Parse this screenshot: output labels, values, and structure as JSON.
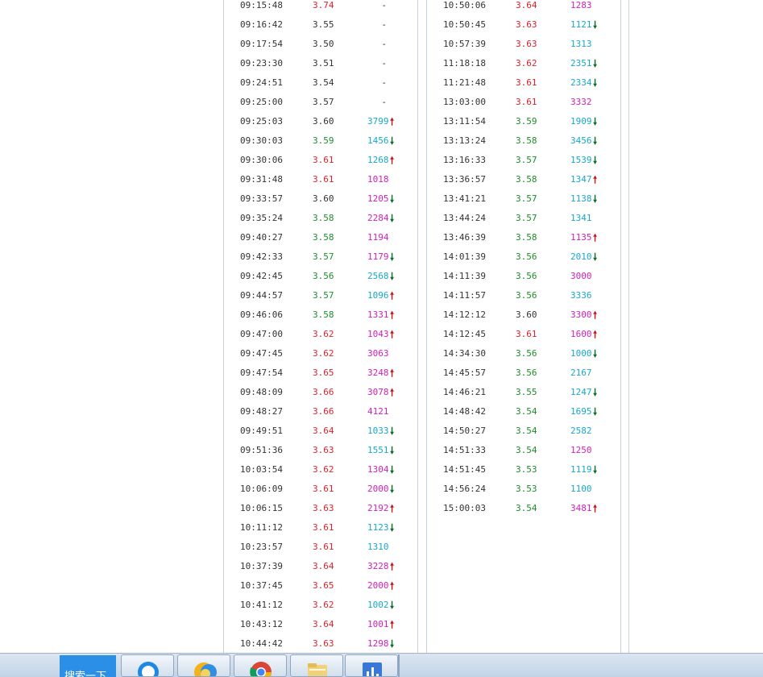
{
  "left_trades": [
    {
      "time": "09:15:48",
      "price": "3.74",
      "price_color": "red",
      "volume": "-",
      "volume_color": "dark",
      "arrow": ""
    },
    {
      "time": "09:16:42",
      "price": "3.55",
      "price_color": "dark",
      "volume": "-",
      "volume_color": "dark",
      "arrow": ""
    },
    {
      "time": "09:17:54",
      "price": "3.50",
      "price_color": "dark",
      "volume": "-",
      "volume_color": "dark",
      "arrow": ""
    },
    {
      "time": "09:23:30",
      "price": "3.51",
      "price_color": "dark",
      "volume": "-",
      "volume_color": "dark",
      "arrow": ""
    },
    {
      "time": "09:24:51",
      "price": "3.54",
      "price_color": "dark",
      "volume": "-",
      "volume_color": "dark",
      "arrow": ""
    },
    {
      "time": "09:25:00",
      "price": "3.57",
      "price_color": "dark",
      "volume": "-",
      "volume_color": "dark",
      "arrow": ""
    },
    {
      "time": "09:25:03",
      "price": "3.60",
      "price_color": "dark",
      "volume": "3799",
      "volume_color": "cyan",
      "arrow": "up"
    },
    {
      "time": "09:30:03",
      "price": "3.59",
      "price_color": "green",
      "volume": "1456",
      "volume_color": "cyan",
      "arrow": "down"
    },
    {
      "time": "09:30:06",
      "price": "3.61",
      "price_color": "red",
      "volume": "1268",
      "volume_color": "cyan",
      "arrow": "up"
    },
    {
      "time": "09:31:48",
      "price": "3.61",
      "price_color": "red",
      "volume": "1018",
      "volume_color": "magenta",
      "arrow": ""
    },
    {
      "time": "09:33:57",
      "price": "3.60",
      "price_color": "dark",
      "volume": "1205",
      "volume_color": "magenta",
      "arrow": "down"
    },
    {
      "time": "09:35:24",
      "price": "3.58",
      "price_color": "green",
      "volume": "2284",
      "volume_color": "magenta",
      "arrow": "down"
    },
    {
      "time": "09:40:27",
      "price": "3.58",
      "price_color": "green",
      "volume": "1194",
      "volume_color": "magenta",
      "arrow": ""
    },
    {
      "time": "09:42:33",
      "price": "3.57",
      "price_color": "green",
      "volume": "1179",
      "volume_color": "magenta",
      "arrow": "down"
    },
    {
      "time": "09:42:45",
      "price": "3.56",
      "price_color": "green",
      "volume": "2568",
      "volume_color": "cyan",
      "arrow": "down"
    },
    {
      "time": "09:44:57",
      "price": "3.57",
      "price_color": "green",
      "volume": "1096",
      "volume_color": "cyan",
      "arrow": "up"
    },
    {
      "time": "09:46:06",
      "price": "3.58",
      "price_color": "green",
      "volume": "1331",
      "volume_color": "magenta",
      "arrow": "up"
    },
    {
      "time": "09:47:00",
      "price": "3.62",
      "price_color": "red",
      "volume": "1043",
      "volume_color": "magenta",
      "arrow": "up"
    },
    {
      "time": "09:47:45",
      "price": "3.62",
      "price_color": "red",
      "volume": "3063",
      "volume_color": "magenta",
      "arrow": ""
    },
    {
      "time": "09:47:54",
      "price": "3.65",
      "price_color": "red",
      "volume": "3248",
      "volume_color": "magenta",
      "arrow": "up"
    },
    {
      "time": "09:48:09",
      "price": "3.66",
      "price_color": "red",
      "volume": "3078",
      "volume_color": "magenta",
      "arrow": "up"
    },
    {
      "time": "09:48:27",
      "price": "3.66",
      "price_color": "red",
      "volume": "4121",
      "volume_color": "magenta",
      "arrow": ""
    },
    {
      "time": "09:49:51",
      "price": "3.64",
      "price_color": "red",
      "volume": "1033",
      "volume_color": "cyan",
      "arrow": "down"
    },
    {
      "time": "09:51:36",
      "price": "3.63",
      "price_color": "red",
      "volume": "1551",
      "volume_color": "cyan",
      "arrow": "down"
    },
    {
      "time": "10:03:54",
      "price": "3.62",
      "price_color": "red",
      "volume": "1304",
      "volume_color": "magenta",
      "arrow": "down"
    },
    {
      "time": "10:06:09",
      "price": "3.61",
      "price_color": "red",
      "volume": "2000",
      "volume_color": "magenta",
      "arrow": "down"
    },
    {
      "time": "10:06:15",
      "price": "3.63",
      "price_color": "red",
      "volume": "2192",
      "volume_color": "magenta",
      "arrow": "up"
    },
    {
      "time": "10:11:12",
      "price": "3.61",
      "price_color": "red",
      "volume": "1123",
      "volume_color": "cyan",
      "arrow": "down"
    },
    {
      "time": "10:23:57",
      "price": "3.61",
      "price_color": "red",
      "volume": "1310",
      "volume_color": "cyan",
      "arrow": ""
    },
    {
      "time": "10:37:39",
      "price": "3.64",
      "price_color": "red",
      "volume": "3228",
      "volume_color": "magenta",
      "arrow": "up"
    },
    {
      "time": "10:37:45",
      "price": "3.65",
      "price_color": "red",
      "volume": "2000",
      "volume_color": "magenta",
      "arrow": "up"
    },
    {
      "time": "10:41:12",
      "price": "3.62",
      "price_color": "red",
      "volume": "1002",
      "volume_color": "cyan",
      "arrow": "down"
    },
    {
      "time": "10:43:12",
      "price": "3.64",
      "price_color": "red",
      "volume": "1001",
      "volume_color": "magenta",
      "arrow": "up"
    },
    {
      "time": "10:44:42",
      "price": "3.63",
      "price_color": "red",
      "volume": "1298",
      "volume_color": "magenta",
      "arrow": "down"
    }
  ],
  "right_trades": [
    {
      "time": "10:50:06",
      "price": "3.64",
      "price_color": "red",
      "volume": "1283",
      "volume_color": "magenta",
      "arrow": ""
    },
    {
      "time": "10:50:45",
      "price": "3.63",
      "price_color": "red",
      "volume": "1121",
      "volume_color": "cyan",
      "arrow": "down"
    },
    {
      "time": "10:57:39",
      "price": "3.63",
      "price_color": "red",
      "volume": "1313",
      "volume_color": "cyan",
      "arrow": ""
    },
    {
      "time": "11:18:18",
      "price": "3.62",
      "price_color": "red",
      "volume": "2351",
      "volume_color": "cyan",
      "arrow": "down"
    },
    {
      "time": "11:21:48",
      "price": "3.61",
      "price_color": "red",
      "volume": "2334",
      "volume_color": "cyan",
      "arrow": "down"
    },
    {
      "time": "13:03:00",
      "price": "3.61",
      "price_color": "red",
      "volume": "3332",
      "volume_color": "magenta",
      "arrow": ""
    },
    {
      "time": "13:11:54",
      "price": "3.59",
      "price_color": "green",
      "volume": "1909",
      "volume_color": "cyan",
      "arrow": "down"
    },
    {
      "time": "13:13:24",
      "price": "3.58",
      "price_color": "green",
      "volume": "3456",
      "volume_color": "cyan",
      "arrow": "down"
    },
    {
      "time": "13:16:33",
      "price": "3.57",
      "price_color": "green",
      "volume": "1539",
      "volume_color": "cyan",
      "arrow": "down"
    },
    {
      "time": "13:36:57",
      "price": "3.58",
      "price_color": "green",
      "volume": "1347",
      "volume_color": "cyan",
      "arrow": "up"
    },
    {
      "time": "13:41:21",
      "price": "3.57",
      "price_color": "green",
      "volume": "1138",
      "volume_color": "cyan",
      "arrow": "down"
    },
    {
      "time": "13:44:24",
      "price": "3.57",
      "price_color": "green",
      "volume": "1341",
      "volume_color": "cyan",
      "arrow": ""
    },
    {
      "time": "13:46:39",
      "price": "3.58",
      "price_color": "green",
      "volume": "1135",
      "volume_color": "magenta",
      "arrow": "up"
    },
    {
      "time": "14:01:39",
      "price": "3.56",
      "price_color": "green",
      "volume": "2010",
      "volume_color": "cyan",
      "arrow": "down"
    },
    {
      "time": "14:11:39",
      "price": "3.56",
      "price_color": "green",
      "volume": "3000",
      "volume_color": "magenta",
      "arrow": ""
    },
    {
      "time": "14:11:57",
      "price": "3.56",
      "price_color": "green",
      "volume": "3336",
      "volume_color": "cyan",
      "arrow": ""
    },
    {
      "time": "14:12:12",
      "price": "3.60",
      "price_color": "dark",
      "volume": "3300",
      "volume_color": "magenta",
      "arrow": "up"
    },
    {
      "time": "14:12:45",
      "price": "3.61",
      "price_color": "red",
      "volume": "1600",
      "volume_color": "magenta",
      "arrow": "up"
    },
    {
      "time": "14:34:30",
      "price": "3.56",
      "price_color": "green",
      "volume": "1000",
      "volume_color": "cyan",
      "arrow": "down"
    },
    {
      "time": "14:45:57",
      "price": "3.56",
      "price_color": "green",
      "volume": "2167",
      "volume_color": "cyan",
      "arrow": ""
    },
    {
      "time": "14:46:21",
      "price": "3.55",
      "price_color": "green",
      "volume": "1247",
      "volume_color": "cyan",
      "arrow": "down"
    },
    {
      "time": "14:48:42",
      "price": "3.54",
      "price_color": "green",
      "volume": "1695",
      "volume_color": "cyan",
      "arrow": "down"
    },
    {
      "time": "14:50:27",
      "price": "3.54",
      "price_color": "green",
      "volume": "2582",
      "volume_color": "cyan",
      "arrow": ""
    },
    {
      "time": "14:51:33",
      "price": "3.54",
      "price_color": "green",
      "volume": "1250",
      "volume_color": "magenta",
      "arrow": ""
    },
    {
      "time": "14:51:45",
      "price": "3.53",
      "price_color": "green",
      "volume": "1119",
      "volume_color": "cyan",
      "arrow": "down"
    },
    {
      "time": "14:56:24",
      "price": "3.53",
      "price_color": "green",
      "volume": "1100",
      "volume_color": "cyan",
      "arrow": ""
    },
    {
      "time": "15:00:03",
      "price": "3.54",
      "price_color": "green",
      "volume": "3481",
      "volume_color": "magenta",
      "arrow": "up"
    }
  ],
  "arrows": {
    "up": "🠕",
    "down": "🠗"
  },
  "taskbar": {
    "search_label": "搜索一下",
    "apps": [
      {
        "name": "browser-360-icon"
      },
      {
        "name": "sunflower-app-icon"
      },
      {
        "name": "chrome-icon"
      },
      {
        "name": "file-explorer-icon"
      },
      {
        "name": "chart-app-icon"
      }
    ]
  },
  "colors": {
    "up_red": "#d9232b",
    "down_green": "#1e8a2c",
    "neutral": "#333333",
    "volume_cyan": "#1aa7c9",
    "volume_magenta": "#cf22b7",
    "arrow_up": "#c21818",
    "arrow_down": "#0a6b2a",
    "taskbar_blue": "#2b8fe8"
  }
}
